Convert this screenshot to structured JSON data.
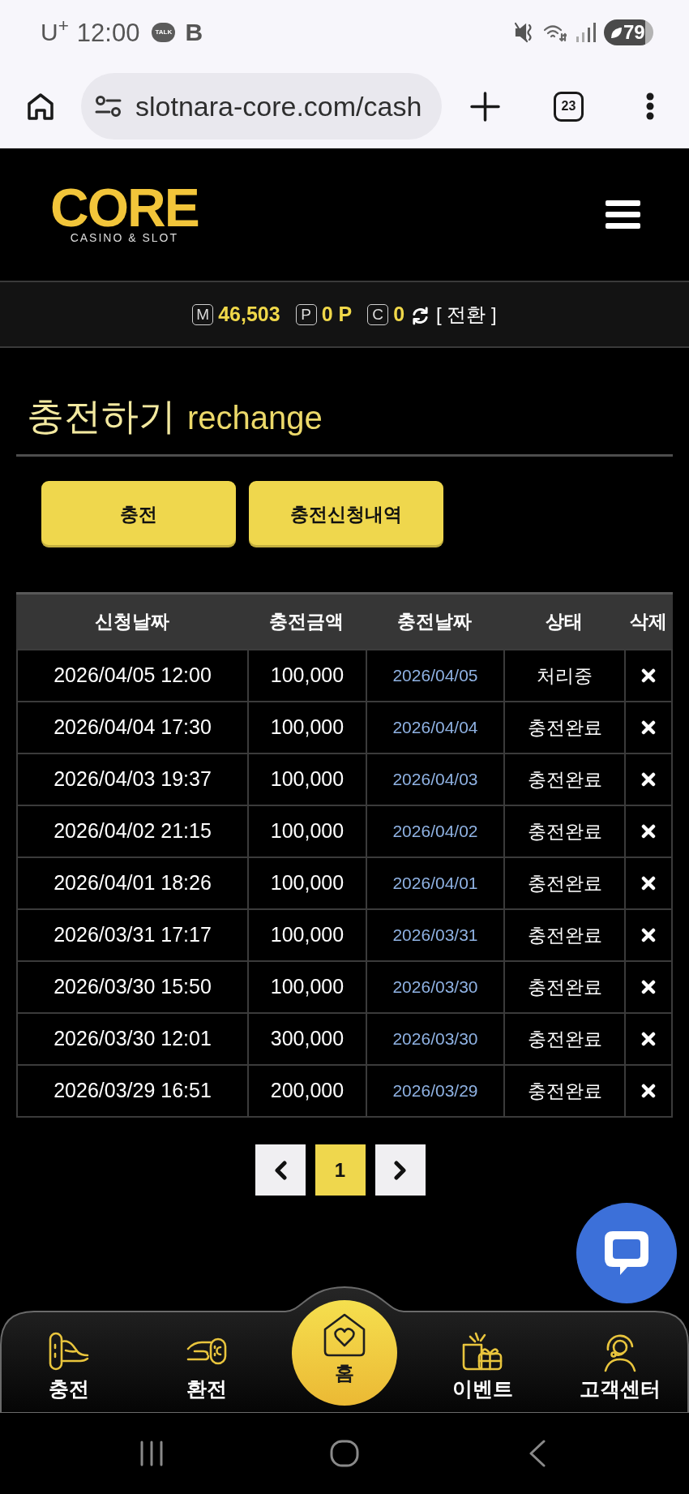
{
  "status_bar": {
    "carrier": "U$^{+}$",
    "time": "12:00",
    "notifications": [
      {
        "kind": "talk",
        "label": "TALK"
      },
      {
        "kind": "band",
        "label": "B"
      }
    ],
    "battery": "79"
  },
  "browser": {
    "url": "slotnara-core.com/cash",
    "tab_count": "23"
  },
  "header": {
    "logo": "CORE",
    "logo_tagline": "CASINO & SLOT"
  },
  "balance_bar": {
    "items": [
      {
        "badge": "M",
        "value": "46,503"
      },
      {
        "badge": "P",
        "value": "0 P"
      },
      {
        "badge": "C",
        "value": "0"
      }
    ],
    "convert": "[ 전환 ]"
  },
  "page": {
    "title": "충전하기",
    "subtitle": "rechange"
  },
  "buttons": [
    {
      "label": "충전"
    },
    {
      "label": "충전신청내역"
    }
  ],
  "table": {
    "columns": [
      "신청날짜",
      "충전금액",
      "충전날짜",
      "상태",
      "삭제"
    ],
    "rows": [
      {
        "requested": "2026/04/05 12:00",
        "amount": "100,000",
        "charged": "2026/04/05",
        "status": "처리중"
      },
      {
        "requested": "2026/04/04 17:30",
        "amount": "100,000",
        "charged": "2026/04/04",
        "status": "충전완료"
      },
      {
        "requested": "2026/04/03 19:37",
        "amount": "100,000",
        "charged": "2026/04/03",
        "status": "충전완료"
      },
      {
        "requested": "2026/04/02 21:15",
        "amount": "100,000",
        "charged": "2026/04/02",
        "status": "충전완료"
      },
      {
        "requested": "2026/04/01 18:26",
        "amount": "100,000",
        "charged": "2026/04/01",
        "status": "충전완료"
      },
      {
        "requested": "2026/03/31 17:17",
        "amount": "100,000",
        "charged": "2026/03/31",
        "status": "충전완료"
      },
      {
        "requested": "2026/03/30 15:50",
        "amount": "100,000",
        "charged": "2026/03/30",
        "status": "충전완료"
      },
      {
        "requested": "2026/03/30 12:01",
        "amount": "300,000",
        "charged": "2026/03/30",
        "status": "충전완료"
      },
      {
        "requested": "2026/03/29 16:51",
        "amount": "200,000",
        "charged": "2026/03/29",
        "status": "충전완료"
      }
    ]
  },
  "pagination": {
    "pages": [
      {
        "label": "1",
        "selected": true
      }
    ]
  },
  "bottom_nav": [
    {
      "kind": "charge",
      "label": "충전"
    },
    {
      "kind": "exchange",
      "label": "환전"
    },
    {
      "kind": "home",
      "label": "홈"
    },
    {
      "kind": "event",
      "label": "이벤트"
    },
    {
      "kind": "support",
      "label": "고객센터"
    }
  ]
}
